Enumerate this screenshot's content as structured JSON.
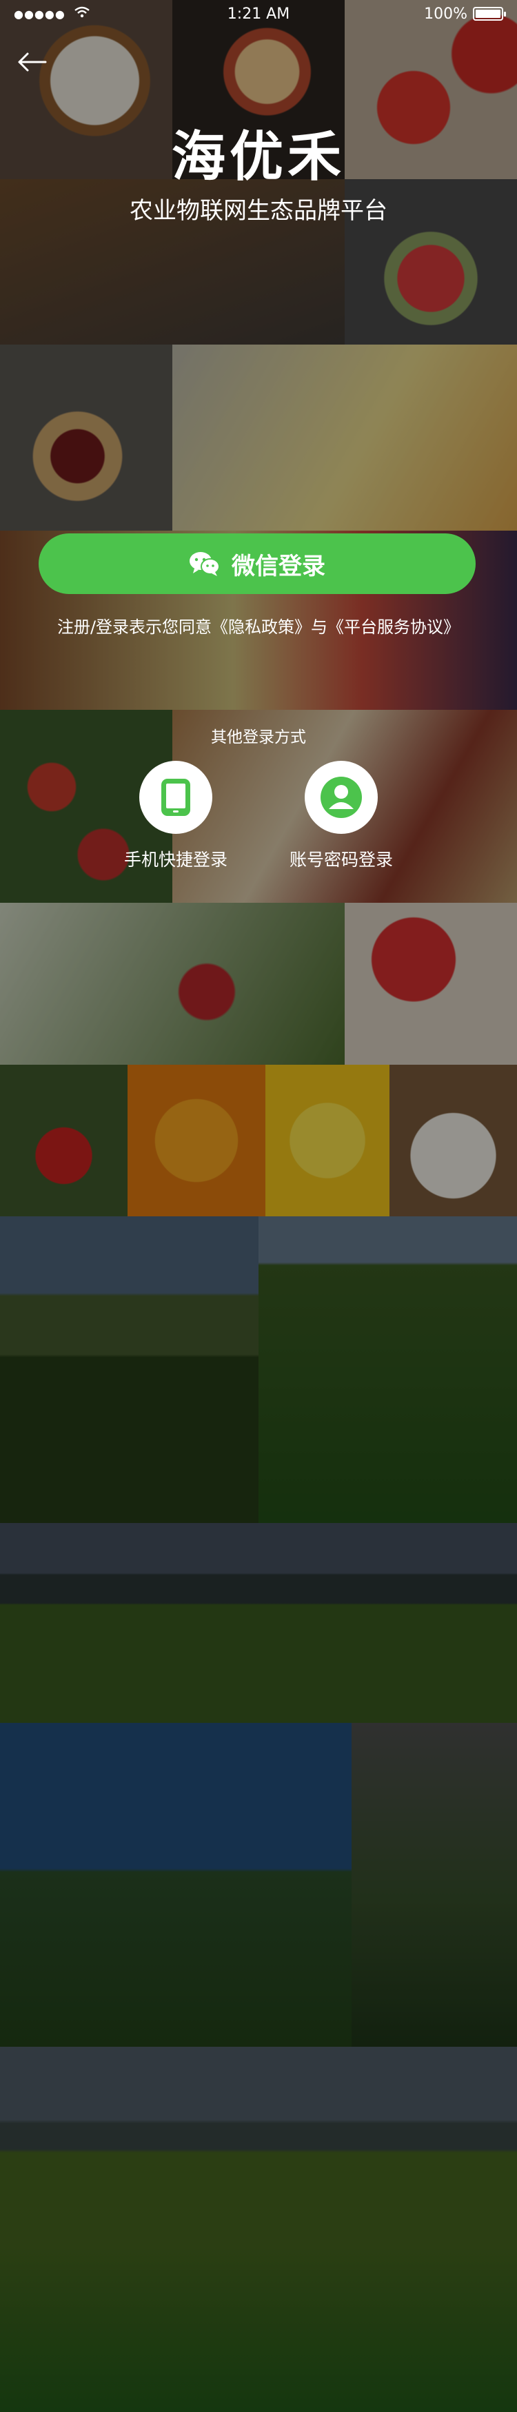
{
  "status_bar": {
    "time": "1:21 AM",
    "battery": "100%"
  },
  "header": {
    "title": "海优禾",
    "subtitle": "农业物联网生态品牌平台"
  },
  "wechat_login": {
    "label": "微信登录"
  },
  "agreement": {
    "prefix": "注册/登录表示您同意",
    "privacy": "《隐私政策》",
    "and": "与",
    "service": "《平台服务协议》"
  },
  "other_login": {
    "title": "其他登录方式",
    "options": [
      {
        "label": "手机快捷登录",
        "icon": "phone-icon"
      },
      {
        "label": "账号密码登录",
        "icon": "user-icon"
      }
    ]
  },
  "colors": {
    "accent": "#4cc34c"
  }
}
